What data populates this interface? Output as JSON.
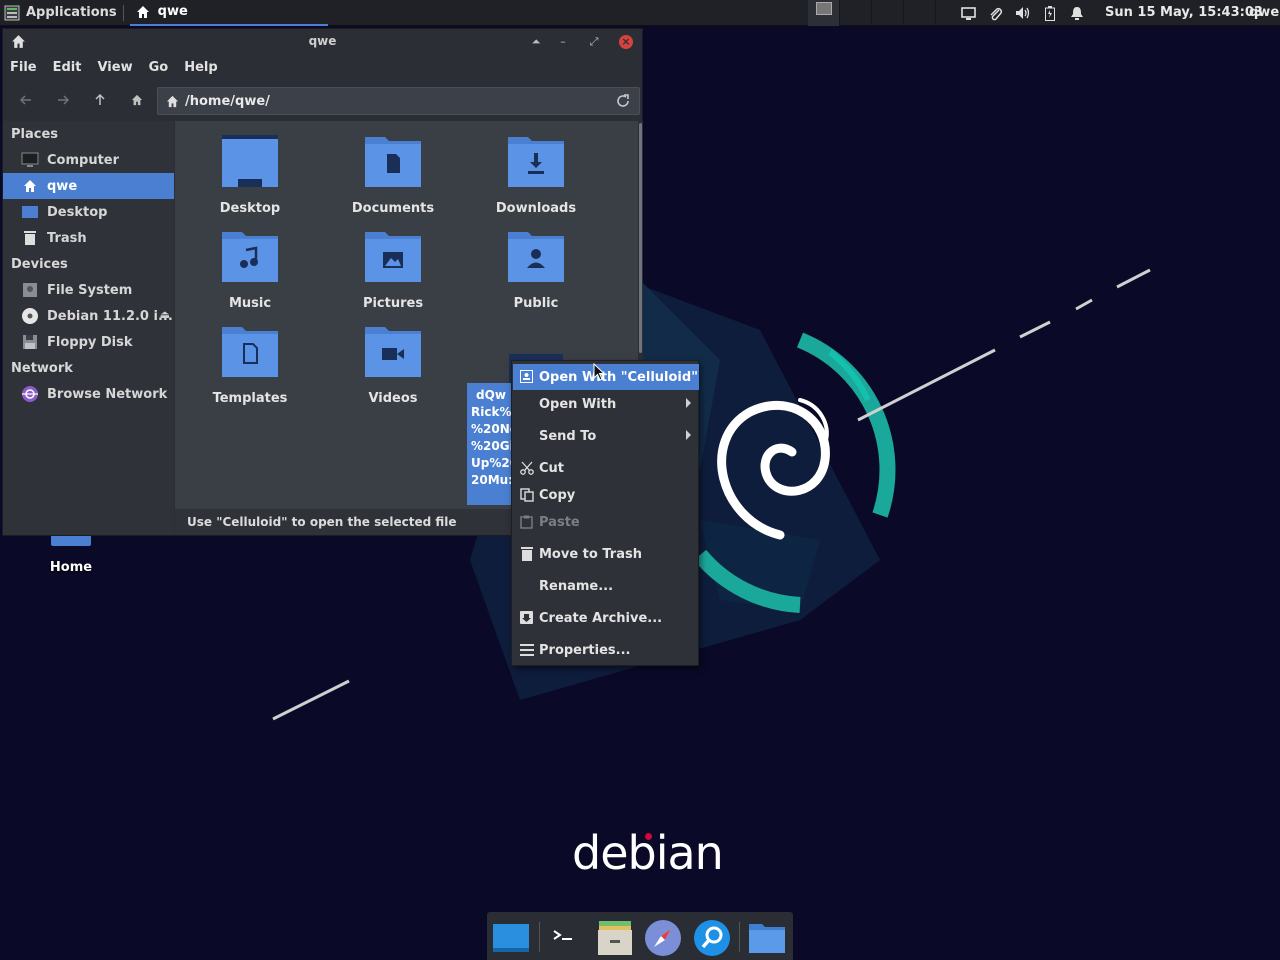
{
  "top_panel": {
    "applications_label": "Applications",
    "task_label": "qwe",
    "clock": "Sun 15 May, 15:43:03",
    "user": "qwe",
    "tray_icons": [
      "display-icon",
      "clip-icon",
      "volume-icon",
      "battery-icon",
      "notification-icon"
    ]
  },
  "window": {
    "title": "qwe",
    "menu": [
      "File",
      "Edit",
      "View",
      "Go",
      "Help"
    ],
    "location_path": "/home/qwe/",
    "status_text": "Use \"Celluloid\" to open the selected file"
  },
  "sidebar": {
    "places_heading": "Places",
    "devices_heading": "Devices",
    "network_heading": "Network",
    "places": [
      {
        "label": "Computer",
        "icon": "computer-icon"
      },
      {
        "label": "qwe",
        "icon": "home-icon",
        "selected": true
      },
      {
        "label": "Desktop",
        "icon": "desktop-icon"
      },
      {
        "label": "Trash",
        "icon": "trash-icon"
      }
    ],
    "devices": [
      {
        "label": "File System",
        "icon": "drive-icon"
      },
      {
        "label": "Debian 11.2.0 i...",
        "icon": "disc-icon"
      },
      {
        "label": "Floppy Disk",
        "icon": "floppy-icon"
      }
    ],
    "network": [
      {
        "label": "Browse Network",
        "icon": "network-icon"
      }
    ]
  },
  "files": [
    {
      "label": "Desktop",
      "icon": "folder-desktop-icon"
    },
    {
      "label": "Documents",
      "icon": "folder-documents-icon"
    },
    {
      "label": "Downloads",
      "icon": "folder-downloads-icon"
    },
    {
      "label": "Music",
      "icon": "folder-music-icon"
    },
    {
      "label": "Pictures",
      "icon": "folder-pictures-icon"
    },
    {
      "label": "Public",
      "icon": "folder-public-icon"
    },
    {
      "label": "Templates",
      "icon": "folder-templates-icon"
    },
    {
      "label": "Videos",
      "icon": "folder-videos-icon"
    }
  ],
  "selected_file_label_lines": [
    "dQw",
    "Rick%2",
    "%20Ne",
    "%20Giv",
    "Up%20",
    "20Mu:"
  ],
  "context_menu": {
    "items": [
      {
        "label": "Open With \"Celluloid\"",
        "icon": "celluloid-icon",
        "hover": true
      },
      {
        "label": "Open With",
        "submenu": true
      },
      {
        "label": "Send To",
        "submenu": true
      },
      {
        "label": "Cut",
        "icon": "cut-icon"
      },
      {
        "label": "Copy",
        "icon": "copy-icon"
      },
      {
        "label": "Paste",
        "icon": "paste-icon",
        "disabled": true
      },
      {
        "label": "Move to Trash",
        "icon": "trash-icon"
      },
      {
        "label": "Rename..."
      },
      {
        "label": "Create Archive...",
        "icon": "archive-icon"
      },
      {
        "label": "Properties...",
        "icon": "properties-icon"
      }
    ]
  },
  "desktop": {
    "home_icon_label": "Home",
    "logo_text": "debian"
  },
  "dock": {
    "items": [
      "show-desktop-icon",
      "terminal-icon",
      "file-manager-icon",
      "web-browser-icon",
      "app-finder-icon",
      "folder-icon"
    ]
  },
  "colors": {
    "accent": "#4a7fd1",
    "folder": "#5b93e6",
    "teal_swirl": "#1aa89a",
    "background": "#0b0b2a",
    "close_button": "#d6433f"
  }
}
